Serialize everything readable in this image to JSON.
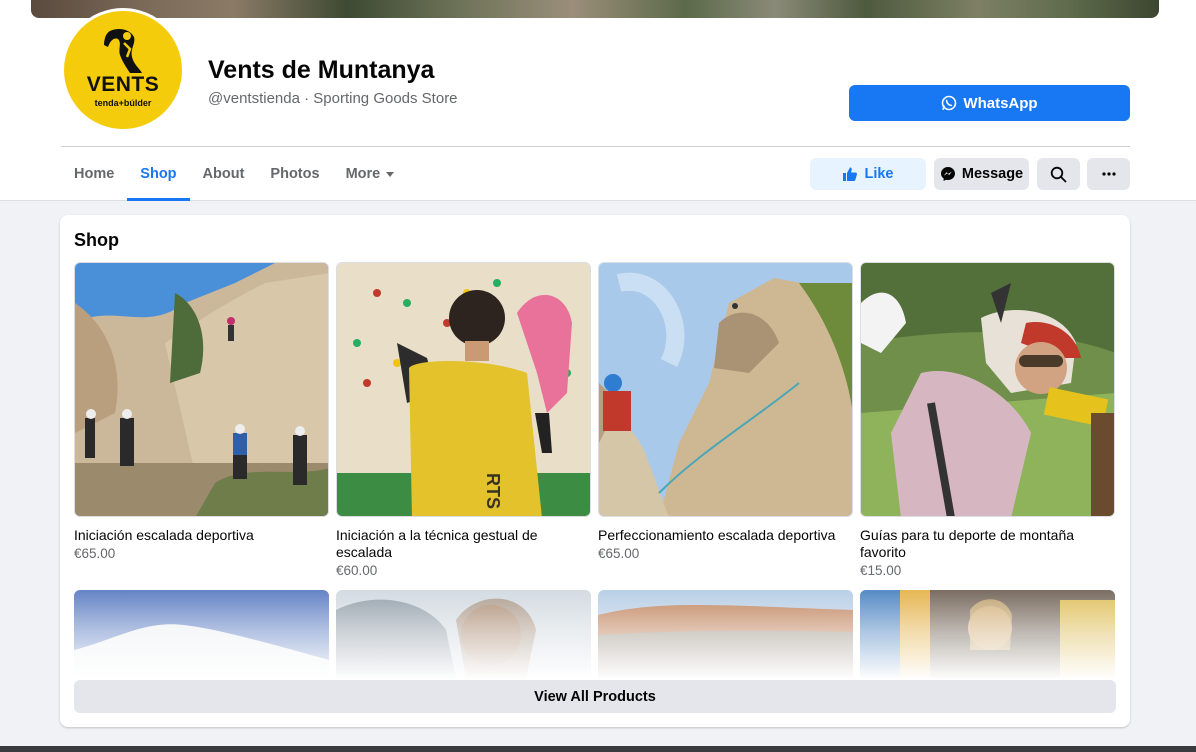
{
  "page": {
    "name": "Vents de Muntanya",
    "handle_category": "@ventstienda · Sporting Goods Store",
    "logo_text": "VENTS",
    "logo_sub": "tenda+búlder"
  },
  "header": {
    "whatsapp_label": "WhatsApp"
  },
  "tabs": [
    {
      "label": "Home"
    },
    {
      "label": "Shop",
      "active": true
    },
    {
      "label": "About"
    },
    {
      "label": "Photos"
    },
    {
      "label": "More"
    }
  ],
  "actions": {
    "like_label": "Like",
    "message_label": "Message"
  },
  "shop": {
    "title": "Shop",
    "products": [
      {
        "name": "Iniciación escalada deportiva",
        "price": "€65.00"
      },
      {
        "name": "Iniciación a la técnica gestual de escalada",
        "price": "€60.00"
      },
      {
        "name": "Perfeccionamiento escalada deportiva",
        "price": "€65.00"
      },
      {
        "name": "Guías para tu deporte de montaña favorito",
        "price": "€15.00"
      }
    ],
    "view_all_label": "View All Products"
  },
  "colors": {
    "accent": "#1877f2",
    "logo_yellow": "#f5cc0c"
  }
}
